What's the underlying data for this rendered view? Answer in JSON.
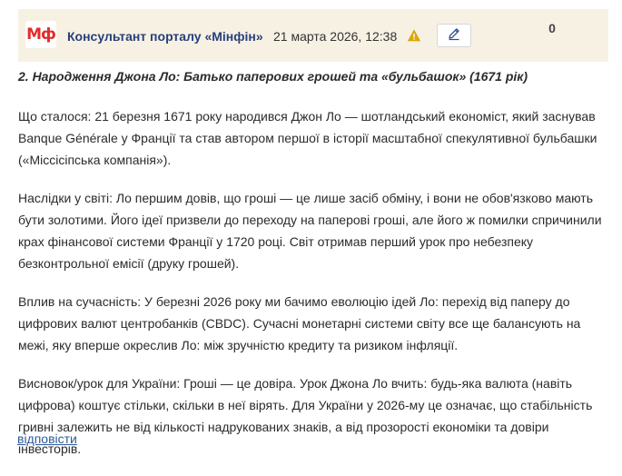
{
  "header": {
    "logo_text": "Мф",
    "author": "Консультант порталу «Мінфін»",
    "datetime": "21 марта 2026, 12:38",
    "warn_icon": "warning-icon",
    "edit_icon": "pencil-icon",
    "rating": "0"
  },
  "post": {
    "title": "2. Народження Джона Ло: Батько паперових грошей та «бульбашок» (1671 рік)",
    "paragraphs": [
      "Що сталося: 21 березня 1671 року народився Джон Ло — шотландський економіст, який заснував Banque Générale у Франції та став автором першої в історії масштабної спекулятивної бульбашки («Міссісіпська компанія»).",
      "Наслідки у світі: Ло першим довів, що гроші — це лише засіб обміну, і вони не обов'язково мають бути золотими. Його ідеї призвели до переходу на паперові гроші, але його ж помилки спричинили крах фінансової системи Франції у 1720 році. Світ отримав перший урок про небезпеку безконтрольної емісії (друку грошей).",
      "Вплив на сучасність: У березні 2026 року ми бачимо еволюцію ідей Ло: перехід від паперу до цифрових валют центробанків (CBDC). Сучасні монетарні системи світу все ще балансують на межі, яку вперше окреслив Ло: між зручністю кредиту та ризиком інфляції.",
      "Висновок/урок для України: Гроші — це довіра. Урок Джона Ло вчить: будь-яка валюта (навіть цифрова) коштує стільки, скільки в неї вірять. Для України у 2026-му це означає, що стабільність гривні залежить не від кількості надрукованих знаків, а від прозорості економіки та довіри інвесторів."
    ]
  },
  "actions": {
    "reply_label": "відповісти"
  },
  "colors": {
    "header_bg": "#f7f1e4",
    "logo_red": "#e32b2b",
    "author_blue": "#27407a",
    "link_blue": "#2b5b9c",
    "warning_yellow": "#e0a800"
  }
}
